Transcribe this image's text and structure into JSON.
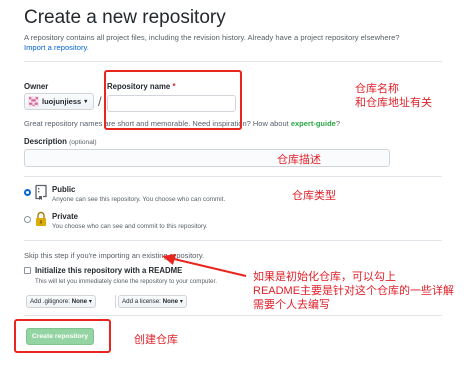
{
  "page": {
    "title": "Create a new repository",
    "subtitle": "A repository contains all project files, including the revision history. Already have a project repository elsewhere?",
    "import_link": "Import a repository."
  },
  "form": {
    "owner_label": "Owner",
    "owner_value": "luojunjiess",
    "owner_caret": "▾",
    "separator": "/",
    "repo_label": "Repository name",
    "required_mark": "*",
    "repo_value": "",
    "name_hint_prefix": "Great repository names are short and memorable. Need inspiration? How about ",
    "name_hint_suggestion": "expert-guide",
    "name_hint_suffix": "?",
    "description_label": "Description",
    "description_optional": "(optional)",
    "description_value": "",
    "visibility": [
      {
        "label": "Public",
        "desc": "Anyone can see this repository. You choose who can commit.",
        "selected": true
      },
      {
        "label": "Private",
        "desc": "You choose who can see and commit to this repository.",
        "selected": false
      }
    ],
    "skip_text": "Skip this step if you're importing an existing repository.",
    "readme_label": "Initialize this repository with a README",
    "readme_desc": "This will let you immediately clone the repository to your computer.",
    "readme_checked": false,
    "gitignore_prefix": "Add .gitignore:",
    "gitignore_value": "None",
    "license_prefix": "Add a license:",
    "license_value": "None",
    "dropdown_caret": "▾",
    "create_button": "Create repository"
  },
  "annotations": {
    "repo_name_note_line1": "仓库名称",
    "repo_name_note_line2": "和仓库地址有关",
    "description_note": "仓库描述",
    "visibility_note": "仓库类型",
    "readme_note_line1": "如果是初始化仓库，可以勾上",
    "readme_note_line2": "README主要是针对这个仓库的一些详解",
    "readme_note_line3": "需要个人去编写",
    "create_note": "创建仓库"
  },
  "colors": {
    "annotation_red": "#e0212a",
    "link_blue": "#0366d6",
    "create_button_green": "#94d3a2",
    "suggestion_green": "#28a745"
  }
}
